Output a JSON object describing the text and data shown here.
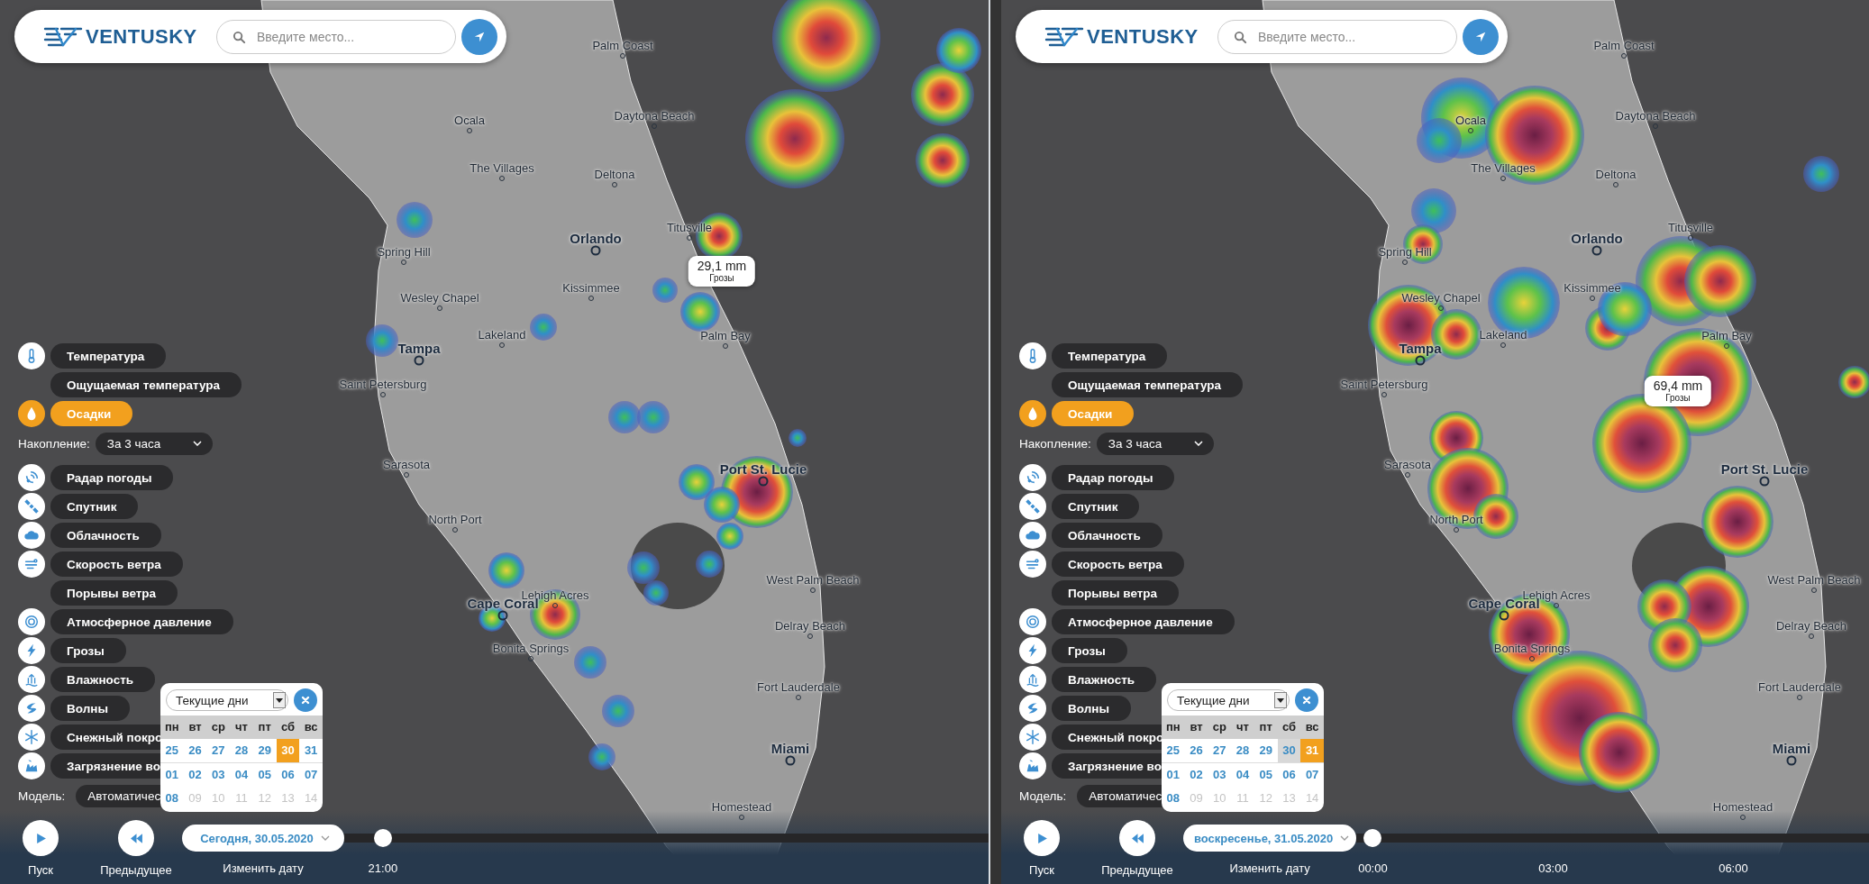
{
  "panels": [
    {
      "header": {
        "logo": "VENTUSKY",
        "search": {
          "placeholder": "Введите место..."
        }
      },
      "sidebar": [
        {
          "kind": "layer",
          "label": "Температура",
          "selected": false
        },
        {
          "kind": "layer",
          "label": "Ощущаемая температура",
          "selected": false
        },
        {
          "kind": "layer",
          "label": "Осадки",
          "selected": true
        },
        {
          "kind": "dropdown",
          "label": "Накопление:",
          "value": "За 3 часа"
        },
        {
          "kind": "layer",
          "label": "Радар погоды",
          "selected": false
        },
        {
          "kind": "layer",
          "label": "Спутник",
          "selected": false
        },
        {
          "kind": "layer",
          "label": "Облачность",
          "selected": false
        },
        {
          "kind": "layer",
          "label": "Скорость ветра",
          "selected": false
        },
        {
          "kind": "layer",
          "label": "Порывы ветра",
          "selected": false
        },
        {
          "kind": "layer",
          "label": "Атмосферное давление",
          "selected": false
        },
        {
          "kind": "layer",
          "label": "Грозы",
          "selected": false
        },
        {
          "kind": "layer",
          "label": "Влажность",
          "selected": false
        },
        {
          "kind": "layer",
          "label": "Волны",
          "selected": false
        },
        {
          "kind": "layer",
          "label": "Снежный покро",
          "selected": false
        },
        {
          "kind": "layer",
          "label": "Загрязнение во",
          "selected": false
        },
        {
          "kind": "model",
          "label": "Модель:",
          "value": "Автоматичес"
        }
      ],
      "calendar": {
        "range": "Текущие дни",
        "weekdays": [
          "пн",
          "вт",
          "ср",
          "чт",
          "пт",
          "сб",
          "вс"
        ],
        "weeks": [
          [
            {
              "day": "25",
              "selected": false,
              "today": false,
              "disabled": false
            },
            {
              "day": "26",
              "selected": false,
              "today": false,
              "disabled": false
            },
            {
              "day": "27",
              "selected": false,
              "today": false,
              "disabled": false
            },
            {
              "day": "28",
              "selected": false,
              "today": false,
              "disabled": false
            },
            {
              "day": "29",
              "selected": false,
              "today": false,
              "disabled": false
            },
            {
              "day": "30",
              "selected": true,
              "today": true,
              "disabled": false
            },
            {
              "day": "31",
              "selected": false,
              "today": false,
              "disabled": false
            }
          ],
          [
            {
              "day": "01",
              "selected": false,
              "today": false,
              "disabled": false
            },
            {
              "day": "02",
              "selected": false,
              "today": false,
              "disabled": false
            },
            {
              "day": "03",
              "selected": false,
              "today": false,
              "disabled": false
            },
            {
              "day": "04",
              "selected": false,
              "today": false,
              "disabled": false
            },
            {
              "day": "05",
              "selected": false,
              "today": false,
              "disabled": false
            },
            {
              "day": "06",
              "selected": false,
              "today": false,
              "disabled": false
            },
            {
              "day": "07",
              "selected": false,
              "today": false,
              "disabled": false
            }
          ],
          [
            {
              "day": "08",
              "selected": false,
              "today": false,
              "disabled": false
            },
            {
              "day": "09",
              "selected": false,
              "today": false,
              "disabled": true
            },
            {
              "day": "10",
              "selected": false,
              "today": false,
              "disabled": true
            },
            {
              "day": "11",
              "selected": false,
              "today": false,
              "disabled": true
            },
            {
              "day": "12",
              "selected": false,
              "today": false,
              "disabled": true
            },
            {
              "day": "13",
              "selected": false,
              "today": false,
              "disabled": true
            },
            {
              "day": "14",
              "selected": false,
              "today": false,
              "disabled": true
            }
          ]
        ]
      },
      "tooltip": {
        "value": "29,1 mm",
        "label": "Грозы"
      },
      "cities": [
        {
          "name": "Palm Coast",
          "kind": "minor"
        },
        {
          "name": "Ocala",
          "kind": "minor"
        },
        {
          "name": "Daytona Beach",
          "kind": "minor"
        },
        {
          "name": "The Villages",
          "kind": "minor"
        },
        {
          "name": "Deltona",
          "kind": "minor"
        },
        {
          "name": "Titusville",
          "kind": "minor"
        },
        {
          "name": "Orlando",
          "kind": "major"
        },
        {
          "name": "Spring Hill",
          "kind": "minor"
        },
        {
          "name": "Kissimmee",
          "kind": "minor"
        },
        {
          "name": "Wesley Chapel",
          "kind": "minor"
        },
        {
          "name": "Lakeland",
          "kind": "minor"
        },
        {
          "name": "Palm Bay",
          "kind": "minor"
        },
        {
          "name": "Tampa",
          "kind": "major"
        },
        {
          "name": "Saint Petersburg",
          "kind": "minor"
        },
        {
          "name": "Sarasota",
          "kind": "minor"
        },
        {
          "name": "Port St. Lucie",
          "kind": "major"
        },
        {
          "name": "North Port",
          "kind": "minor"
        },
        {
          "name": "West Palm Beach",
          "kind": "minor"
        },
        {
          "name": "Lehigh Acres",
          "kind": "minor"
        },
        {
          "name": "Cape Coral",
          "kind": "major"
        },
        {
          "name": "Delray Beach",
          "kind": "minor"
        },
        {
          "name": "Bonita Springs",
          "kind": "minor"
        },
        {
          "name": "Fort Lauderdale",
          "kind": "minor"
        },
        {
          "name": "Miami",
          "kind": "major"
        },
        {
          "name": "Homestead",
          "kind": "minor"
        }
      ],
      "controls": {
        "play": "Пуск",
        "previous": "Предыдущее",
        "change_date": "Изменить дату",
        "date": "Сегодня, 30.05.2020"
      },
      "timeline": {
        "level": 0.06,
        "ticks": [
          "21:00"
        ]
      }
    },
    {
      "header": {
        "logo": "VENTUSKY",
        "search": {
          "placeholder": "Введите место..."
        }
      },
      "sidebar": [
        {
          "kind": "layer",
          "label": "Температура",
          "selected": false
        },
        {
          "kind": "layer",
          "label": "Ощущаемая температура",
          "selected": false
        },
        {
          "kind": "layer",
          "label": "Осадки",
          "selected": true
        },
        {
          "kind": "dropdown",
          "label": "Накопление:",
          "value": "За 3 часа"
        },
        {
          "kind": "layer",
          "label": "Радар погоды",
          "selected": false
        },
        {
          "kind": "layer",
          "label": "Спутник",
          "selected": false
        },
        {
          "kind": "layer",
          "label": "Облачность",
          "selected": false
        },
        {
          "kind": "layer",
          "label": "Скорость ветра",
          "selected": false
        },
        {
          "kind": "layer",
          "label": "Порывы ветра",
          "selected": false
        },
        {
          "kind": "layer",
          "label": "Атмосферное давление",
          "selected": false
        },
        {
          "kind": "layer",
          "label": "Грозы",
          "selected": false
        },
        {
          "kind": "layer",
          "label": "Влажность",
          "selected": false
        },
        {
          "kind": "layer",
          "label": "Волны",
          "selected": false
        },
        {
          "kind": "layer",
          "label": "Снежный покро",
          "selected": false
        },
        {
          "kind": "layer",
          "label": "Загрязнение во",
          "selected": false
        },
        {
          "kind": "model",
          "label": "Модель:",
          "value": "Автоматичес"
        }
      ],
      "calendar": {
        "range": "Текущие дни",
        "weekdays": [
          "пн",
          "вт",
          "ср",
          "чт",
          "пт",
          "сб",
          "вс"
        ],
        "weeks": [
          [
            {
              "day": "25",
              "selected": false,
              "today": false,
              "disabled": false
            },
            {
              "day": "26",
              "selected": false,
              "today": false,
              "disabled": false
            },
            {
              "day": "27",
              "selected": false,
              "today": false,
              "disabled": false
            },
            {
              "day": "28",
              "selected": false,
              "today": false,
              "disabled": false
            },
            {
              "day": "29",
              "selected": false,
              "today": false,
              "disabled": false
            },
            {
              "day": "30",
              "selected": false,
              "today": true,
              "disabled": false
            },
            {
              "day": "31",
              "selected": true,
              "today": false,
              "disabled": false
            }
          ],
          [
            {
              "day": "01",
              "selected": false,
              "today": false,
              "disabled": false
            },
            {
              "day": "02",
              "selected": false,
              "today": false,
              "disabled": false
            },
            {
              "day": "03",
              "selected": false,
              "today": false,
              "disabled": false
            },
            {
              "day": "04",
              "selected": false,
              "today": false,
              "disabled": false
            },
            {
              "day": "05",
              "selected": false,
              "today": false,
              "disabled": false
            },
            {
              "day": "06",
              "selected": false,
              "today": false,
              "disabled": false
            },
            {
              "day": "07",
              "selected": false,
              "today": false,
              "disabled": false
            }
          ],
          [
            {
              "day": "08",
              "selected": false,
              "today": false,
              "disabled": false
            },
            {
              "day": "09",
              "selected": false,
              "today": false,
              "disabled": true
            },
            {
              "day": "10",
              "selected": false,
              "today": false,
              "disabled": true
            },
            {
              "day": "11",
              "selected": false,
              "today": false,
              "disabled": true
            },
            {
              "day": "12",
              "selected": false,
              "today": false,
              "disabled": true
            },
            {
              "day": "13",
              "selected": false,
              "today": false,
              "disabled": true
            },
            {
              "day": "14",
              "selected": false,
              "today": false,
              "disabled": true
            }
          ]
        ]
      },
      "tooltip": {
        "value": "69,4 mm",
        "label": "Грозы"
      },
      "cities": [
        {
          "name": "Palm Coast",
          "kind": "minor"
        },
        {
          "name": "Ocala",
          "kind": "minor"
        },
        {
          "name": "Daytona Beach",
          "kind": "minor"
        },
        {
          "name": "The Villages",
          "kind": "minor"
        },
        {
          "name": "Deltona",
          "kind": "minor"
        },
        {
          "name": "Titusville",
          "kind": "minor"
        },
        {
          "name": "Orlando",
          "kind": "major"
        },
        {
          "name": "Spring Hill",
          "kind": "minor"
        },
        {
          "name": "Kissimmee",
          "kind": "minor"
        },
        {
          "name": "Wesley Chapel",
          "kind": "minor"
        },
        {
          "name": "Lakeland",
          "kind": "minor"
        },
        {
          "name": "Palm Bay",
          "kind": "minor"
        },
        {
          "name": "Tampa",
          "kind": "major"
        },
        {
          "name": "Saint Petersburg",
          "kind": "minor"
        },
        {
          "name": "Sarasota",
          "kind": "minor"
        },
        {
          "name": "Port St. Lucie",
          "kind": "major"
        },
        {
          "name": "North Port",
          "kind": "minor"
        },
        {
          "name": "West Palm Beach",
          "kind": "minor"
        },
        {
          "name": "Lehigh Acres",
          "kind": "minor"
        },
        {
          "name": "Cape Coral",
          "kind": "major"
        },
        {
          "name": "Delray Beach",
          "kind": "minor"
        },
        {
          "name": "Bonita Springs",
          "kind": "minor"
        },
        {
          "name": "Fort Lauderdale",
          "kind": "minor"
        },
        {
          "name": "Miami",
          "kind": "major"
        },
        {
          "name": "Homestead",
          "kind": "minor"
        }
      ],
      "controls": {
        "play": "Пуск",
        "previous": "Предыдущее",
        "change_date": "Изменить дату",
        "date": "воскресенье, 31.05.2020"
      },
      "timeline": {
        "level": 0.026,
        "ticks": [
          "00:00",
          "03:00",
          "06:00"
        ]
      }
    }
  ]
}
